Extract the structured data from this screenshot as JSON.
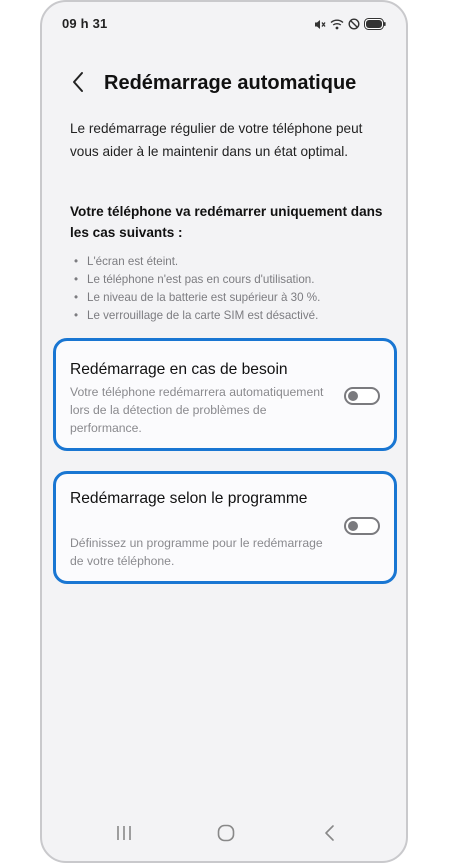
{
  "status_bar": {
    "time": "09 h 31",
    "icons": [
      "mute-icon",
      "wifi-icon",
      "do-not-disturb-icon",
      "battery-icon"
    ]
  },
  "header": {
    "back_icon": "chevron-left-icon",
    "title": "Redémarrage automatique"
  },
  "intro": "Le redémarrage régulier de votre téléphone peut vous aider à le maintenir dans un état optimal.",
  "conditions": {
    "heading": "Votre téléphone va redémarrer uniquement dans les cas suivants :",
    "items": [
      "L'écran est éteint.",
      "Le téléphone n'est pas en cours d'utilisation.",
      "Le niveau de la batterie est supérieur à 30 %.",
      "Le verrouillage de la carte SIM est désactivé."
    ]
  },
  "options": [
    {
      "title": "Redémarrage en cas de besoin",
      "description": "Votre téléphone redémarrera automatiquement lors de la détection de problèmes de performance.",
      "enabled": false
    },
    {
      "title": "Redémarrage selon le programme",
      "description": "Définissez un programme pour le redémarrage de votre téléphone.",
      "enabled": false
    }
  ],
  "nav_bar": {
    "icons": [
      "recent-apps-icon",
      "home-icon",
      "back-icon"
    ]
  },
  "colors": {
    "highlight_border": "#1976d2",
    "background": "#f3f3f5",
    "card_background": "#fbfbfd",
    "toggle_off": "#7a7a7e"
  }
}
